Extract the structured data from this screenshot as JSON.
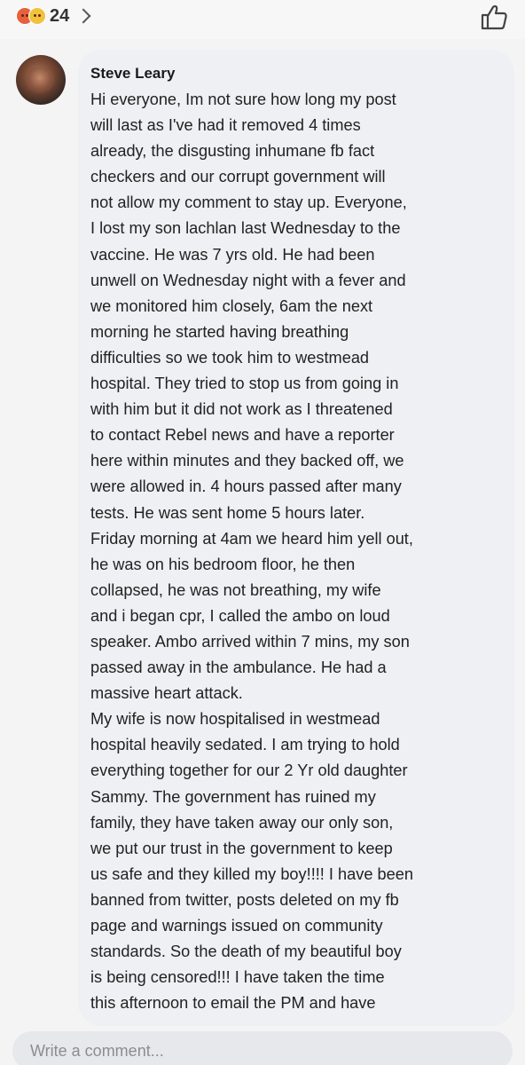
{
  "reactions": {
    "count": "24"
  },
  "comment": {
    "author": "Steve Leary",
    "lines": [
      "Hi everyone, Im not sure how long my post",
      "will last as I've had it removed 4 times",
      "already, the disgusting inhumane fb fact",
      "checkers and our corrupt government will",
      "not allow my comment to stay up. Everyone,",
      "I lost my son lachlan last Wednesday to the",
      "vaccine. He was 7 yrs old. He had been",
      "unwell on Wednesday night with a fever and",
      "we monitored him closely, 6am the next",
      "morning he started having breathing",
      "difficulties so we took him to westmead",
      "hospital. They tried to stop us from going in",
      "with him but it did not work as I threatened",
      "to contact Rebel news and have a reporter",
      "here within minutes and they backed off, we",
      "were allowed in. 4 hours passed after many",
      "tests. He was sent home 5 hours later.",
      "Friday morning at 4am we heard him yell out,",
      "he was on his bedroom floor, he then",
      "collapsed, he was not breathing, my wife",
      "and i began cpr, I called the ambo on loud",
      "speaker. Ambo arrived within 7 mins, my son",
      "passed away in the ambulance. He had a",
      "massive heart attack.",
      "My wife is now hospitalised in westmead",
      "hospital heavily sedated. I am  trying to hold",
      "everything together for our 2 Yr old daughter",
      "Sammy. The government has ruined my",
      "family, they have taken away our only son,",
      "we put our trust in the government to keep",
      "us safe and they killed my boy!!!!  I have been",
      "banned from twitter, posts deleted on my fb",
      "page and warnings issued on community",
      "standards. So the death of my beautiful boy",
      "is being censored!!!  I have taken the time",
      "this afternoon to email the PM and have"
    ]
  },
  "composer": {
    "placeholder": "Write a comment..."
  }
}
